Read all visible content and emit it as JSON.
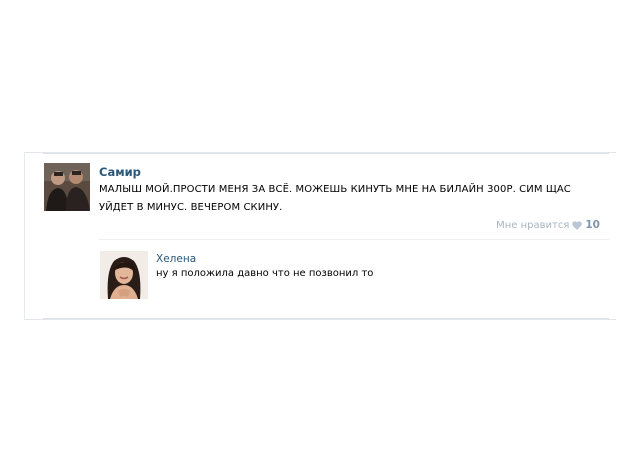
{
  "post": {
    "author": "Самир",
    "text": "МАЛЫШ МОЙ.ПРОСТИ МЕНЯ ЗА ВСЁ. МОЖЕШЬ КИНУТЬ МНЕ НА БИЛАЙН 300Р. СИМ ЩАС УЙДЕТ В МИНУС. ВЕЧЕРОМ СКИНУ.",
    "like_label": "Мне нравится",
    "like_count": "10",
    "like_icon": "heart-icon"
  },
  "reply": {
    "author": "Хелена",
    "text": "ну я положила давно что не позвонил то"
  },
  "colors": {
    "author_link": "#2b587a",
    "like_label": "#a7b4c2",
    "like_count": "#7d95ad"
  }
}
